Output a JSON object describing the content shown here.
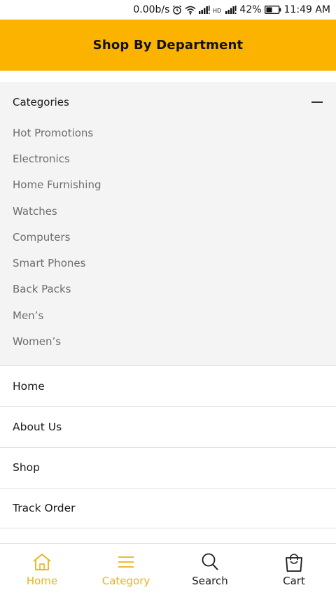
{
  "status_bar": {
    "speed": "0.00b/s",
    "battery": "42%",
    "time": "11:49 AM",
    "icons": [
      "alarm-icon",
      "wifi-icon",
      "signal-icon",
      "hd-icon",
      "signal-icon",
      "battery-icon"
    ]
  },
  "header": {
    "title": "Shop By Department",
    "background": "#FBB300"
  },
  "categories": {
    "heading": "Categories",
    "toggle_icon": "minus-icon",
    "items": [
      {
        "label": "Hot Promotions"
      },
      {
        "label": "Electronics"
      },
      {
        "label": "Home Furnishing"
      },
      {
        "label": "Watches"
      },
      {
        "label": "Computers"
      },
      {
        "label": "Smart Phones"
      },
      {
        "label": "Back Packs"
      },
      {
        "label": "Men’s"
      },
      {
        "label": "Women’s"
      }
    ]
  },
  "menu": {
    "items": [
      {
        "label": "Home"
      },
      {
        "label": "About Us"
      },
      {
        "label": "Shop"
      },
      {
        "label": "Track Order"
      }
    ]
  },
  "bottom_nav": {
    "active_color": "#E9B319",
    "items": [
      {
        "label": "Home",
        "icon": "home-icon",
        "active": true
      },
      {
        "label": "Category",
        "icon": "menu-icon",
        "active": true
      },
      {
        "label": "Search",
        "icon": "search-icon",
        "active": false
      },
      {
        "label": "Cart",
        "icon": "shopping-bag-icon",
        "active": false
      }
    ]
  }
}
